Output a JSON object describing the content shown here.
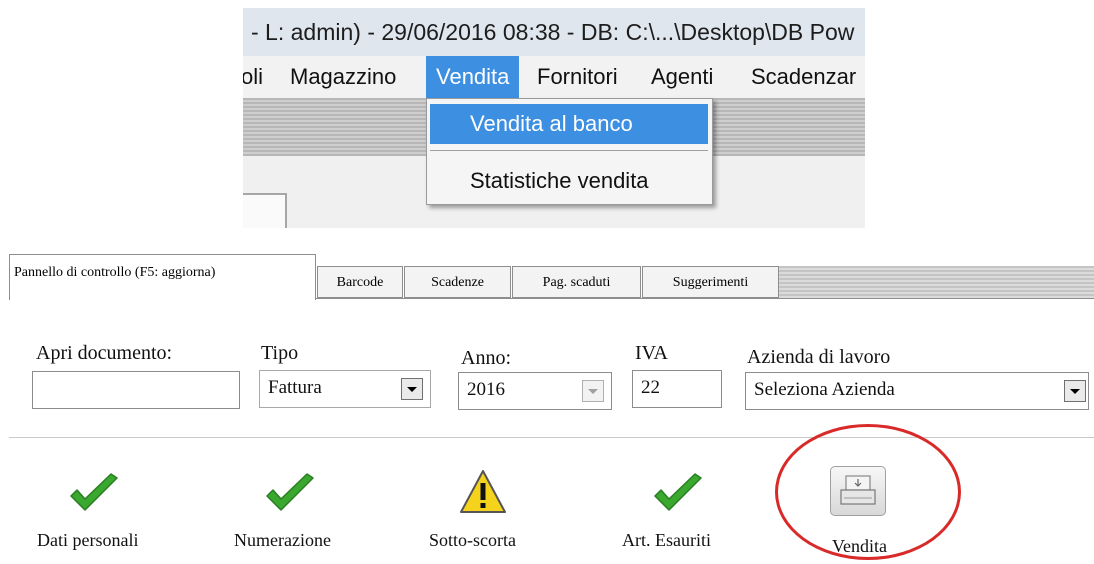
{
  "top_screenshot": {
    "title_bar": "- L: admin) - 29/06/2016 08:38 - DB: C:\\...\\Desktop\\DB Pow",
    "menu": [
      "oli",
      "Magazzino",
      "Vendita",
      "Fornitori",
      "Agenti",
      "Scadenzar"
    ],
    "active_menu": "Vendita",
    "dropdown": {
      "items": [
        "Vendita al banco",
        "Statistiche vendita"
      ],
      "highlighted": "Vendita al banco"
    },
    "colors": {
      "highlight": "#3d8fe1"
    }
  },
  "bottom_screenshot": {
    "tabs": [
      "Pannello di controllo (F5: aggiorna)",
      "Barcode",
      "Scadenze",
      "Pag. scaduti",
      "Suggerimenti"
    ],
    "active_tab": "Pannello di controllo (F5: aggiorna)",
    "form": {
      "apri_documento": {
        "label": "Apri documento:",
        "value": ""
      },
      "tipo": {
        "label": "Tipo",
        "value": "Fattura"
      },
      "anno": {
        "label": "Anno:",
        "value": "2016"
      },
      "iva": {
        "label": "IVA",
        "value": "22"
      },
      "azienda": {
        "label": "Azienda di lavoro",
        "value": "Seleziona Azienda"
      }
    },
    "status": [
      {
        "label": "Dati personali",
        "icon": "check-icon"
      },
      {
        "label": "Numerazione",
        "icon": "check-icon"
      },
      {
        "label": "Sotto-scorta",
        "icon": "warning-icon"
      },
      {
        "label": "Art. Esauriti",
        "icon": "check-icon"
      }
    ],
    "vendita_button": {
      "label": "Vendita",
      "icon": "cash-register-icon"
    },
    "colors": {
      "check": "#3aa82e",
      "warning": "#f5d21c",
      "annotation_circle": "#d92a2a"
    }
  }
}
